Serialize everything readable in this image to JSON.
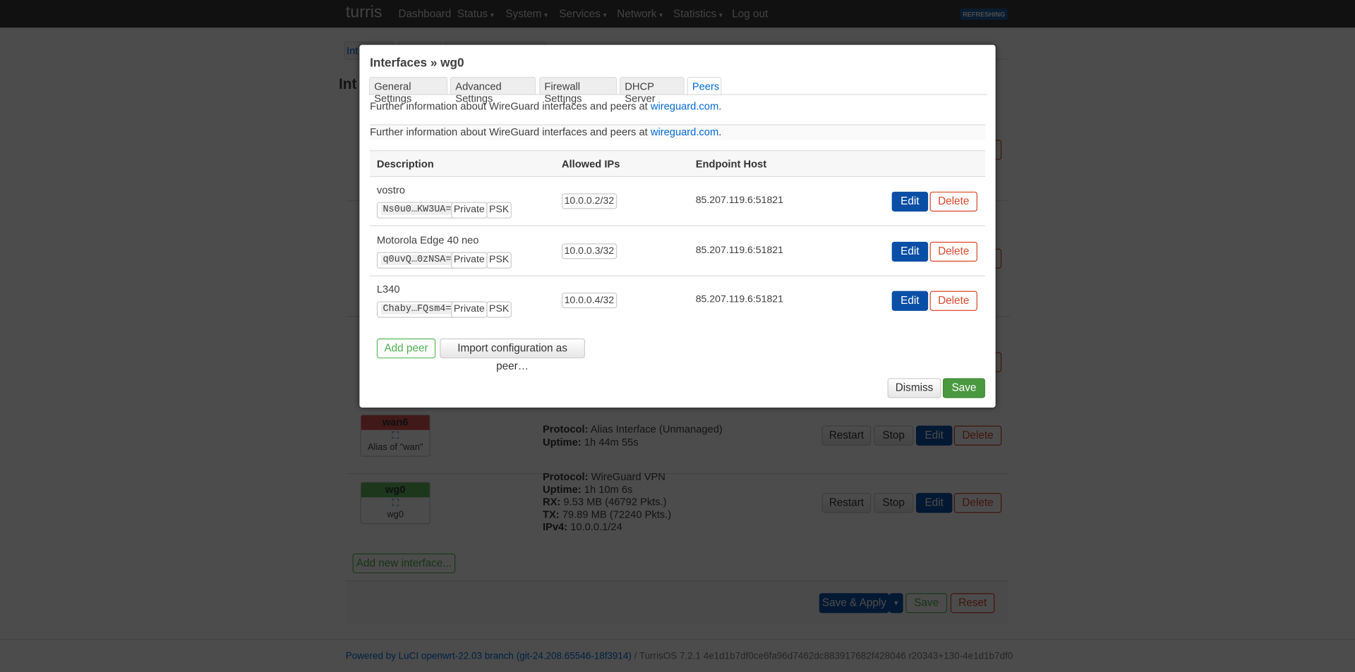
{
  "navbar": {
    "brand": "turris",
    "items": [
      "Dashboard",
      "Status",
      "System",
      "Services",
      "Network",
      "Statistics",
      "Log out"
    ],
    "dropdown_caret": "▾",
    "status_badge": "REFRESHING"
  },
  "page": {
    "tab_partial": "Int",
    "title_partial": "Int",
    "interfaces": [
      {
        "name": "wan6",
        "color": "#d9534f",
        "icon": "ethernet-port-icon",
        "sub": "Alias of \"wan\"",
        "info": [
          [
            "Protocol:",
            "Alias Interface (Unmanaged)"
          ],
          [
            "Uptime:",
            "1h 44m 55s"
          ]
        ]
      },
      {
        "name": "wg0",
        "color": "#5cb85c",
        "icon": "ethernet-port-icon",
        "sub": "wg0",
        "info": [
          [
            "Protocol:",
            "WireGuard VPN"
          ],
          [
            "Uptime:",
            "1h 10m 6s"
          ],
          [
            "RX:",
            "9.53 MB (46792 Pkts.)"
          ],
          [
            "TX:",
            "79.89 MB (72240 Pkts.)"
          ],
          [
            "IPv4:",
            "10.0.0.1/24"
          ]
        ]
      }
    ],
    "row_buttons": {
      "restart": "Restart",
      "stop": "Stop",
      "edit": "Edit",
      "delete": "Delete"
    },
    "add_interface": "Add new interface...",
    "save_apply": "Save & Apply",
    "save": "Save",
    "reset": "Reset",
    "footer_link": "Powered by LuCI openwrt-22.03 branch (git-24.208.65546-18f3914)",
    "footer_text": " / TurrisOS 7.2.1 4e1d1b7df0ce6fa96d7462dc883917682f428046 r20343+130-4e1d1b7df0"
  },
  "modal": {
    "title": "Interfaces » wg0",
    "tabs": [
      "General Settings",
      "Advanced Settings",
      "Firewall Settings",
      "DHCP Server",
      "Peers"
    ],
    "active_tab": "Peers",
    "info_text": "Further information about WireGuard interfaces and peers at ",
    "info_link": "wireguard.com",
    "info_end": ".",
    "columns": [
      "Description",
      "Allowed IPs",
      "Endpoint Host"
    ],
    "peers": [
      {
        "name": "vostro",
        "key": "Ns0u0…KW3UA=",
        "private": "Private",
        "psk": "PSK",
        "allowed_ip": "10.0.0.2/32",
        "endpoint": "85.207.119.6:51821"
      },
      {
        "name": "Motorola Edge 40 neo",
        "key": "q0uvQ…0zNSA=",
        "private": "Private",
        "psk": "PSK",
        "allowed_ip": "10.0.0.3/32",
        "endpoint": "85.207.119.6:51821"
      },
      {
        "name": "L340",
        "key": "Chaby…FQsm4=",
        "private": "Private",
        "psk": "PSK",
        "allowed_ip": "10.0.0.4/32",
        "endpoint": "85.207.119.6:51821"
      }
    ],
    "edit": "Edit",
    "delete": "Delete",
    "add_peer": "Add peer",
    "import_peer": "Import configuration as peer…",
    "dismiss": "Dismiss",
    "save": "Save"
  }
}
